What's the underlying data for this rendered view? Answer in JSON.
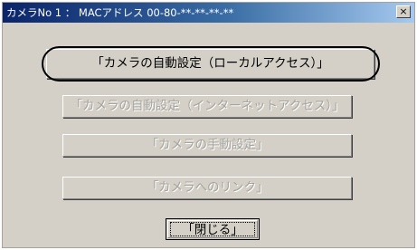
{
  "window": {
    "title": "カメラNo 1 ： MACアドレス 00-80-**-**-**-**",
    "close_glyph": "×"
  },
  "buttons": {
    "auto_local": "「カメラの自動設定（ローカルアクセス）」",
    "auto_internet": "「カメラの自動設定（インターネットアクセス）」",
    "manual": "「カメラの手動設定」",
    "link": "「カメラへのリンク」",
    "close": "「閉じる」"
  }
}
